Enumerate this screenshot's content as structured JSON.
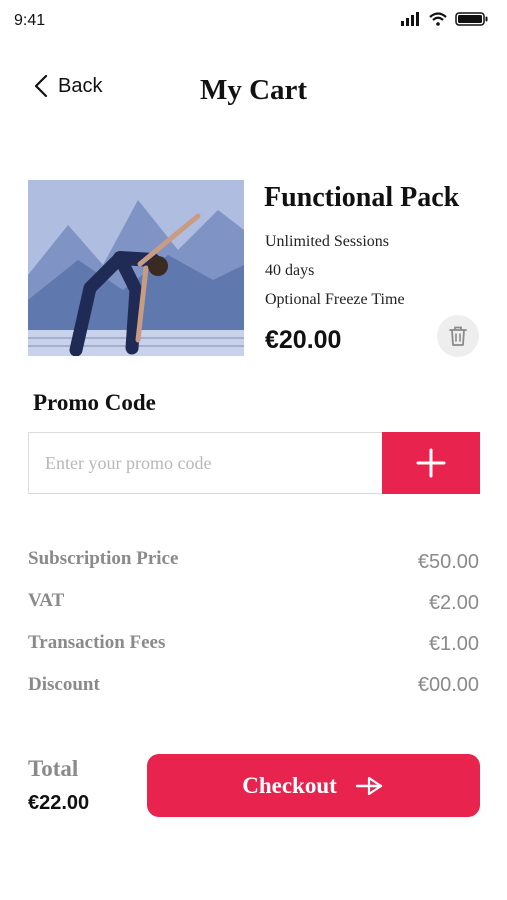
{
  "status_bar": {
    "time": "9:41",
    "icons": [
      "signal-icon",
      "wifi-icon",
      "battery-icon"
    ]
  },
  "nav": {
    "back_label": "Back",
    "title": "My Cart"
  },
  "product": {
    "title": "Functional Pack",
    "features": [
      "Unlimited Sessions",
      "40 days",
      "Optional Freeze Time"
    ],
    "price": "€20.00",
    "image_icon": "yoga-photo",
    "delete_icon": "trash-icon"
  },
  "promo": {
    "heading": "Promo Code",
    "placeholder": "Enter your promo code",
    "value": "",
    "add_icon": "plus-icon"
  },
  "summary": [
    {
      "label": "Subscription Price",
      "value": "€50.00"
    },
    {
      "label": "VAT",
      "value": "€2.00"
    },
    {
      "label": "Transaction Fees",
      "value": "€1.00"
    },
    {
      "label": "Discount",
      "value": "€00.00"
    }
  ],
  "total": {
    "label": "Total",
    "value": "€22.00"
  },
  "checkout": {
    "label": "Checkout",
    "icon": "arrow-right-icon"
  },
  "colors": {
    "accent": "#e8234e",
    "muted_text": "#8a8a8a",
    "primary_text": "#111111"
  }
}
